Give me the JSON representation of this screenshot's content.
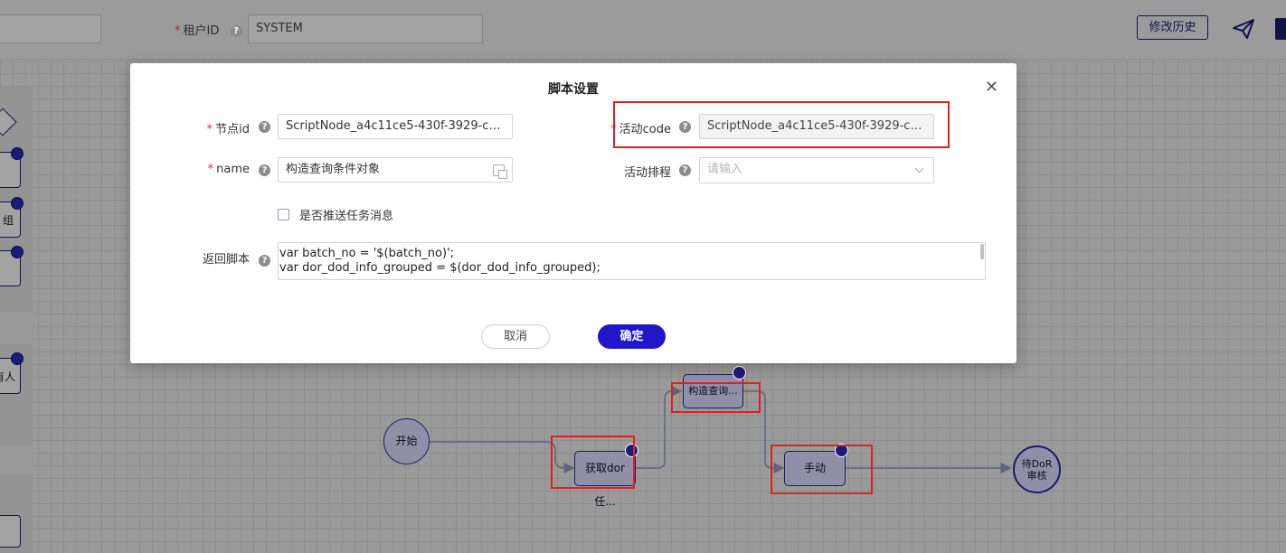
{
  "background": {
    "tenant_label": "租户ID",
    "tenant_value": "SYSTEM",
    "history_button": "修改历史",
    "send_icon": "paper-plane-icon",
    "palette_labels": [
      "组",
      "有人"
    ],
    "nodes": {
      "start": "开始",
      "fetch_task": "获取dor任...",
      "build_query": "构造查询...",
      "manual": "手动",
      "pending_review": "待DoR审核"
    }
  },
  "modal": {
    "title": "脚本设置",
    "close_icon": "close-icon",
    "fields": {
      "node_id_label": "节点id",
      "node_id_value": "ScriptNode_a4c11ce5-430f-3929-c5b...",
      "activity_code_label": "活动code",
      "activity_code_value": "ScriptNode_a4c11ce5-430f-3929-c5b...",
      "name_label": "name",
      "name_value": "构造查询条件对象",
      "schedule_label": "活动排程",
      "schedule_placeholder": "请输入",
      "push_label": "是否推送任务消息",
      "script_label": "返回脚本",
      "script_line1": "var batch_no = '$(batch_no)';",
      "script_line2": "var dor_dod_info_grouped = $(dor_dod_info_grouped);"
    },
    "cancel_label": "取消",
    "confirm_label": "确定"
  },
  "colors": {
    "primary": "#1f18c9",
    "required": "#e0302a",
    "highlight": "#e02020"
  }
}
